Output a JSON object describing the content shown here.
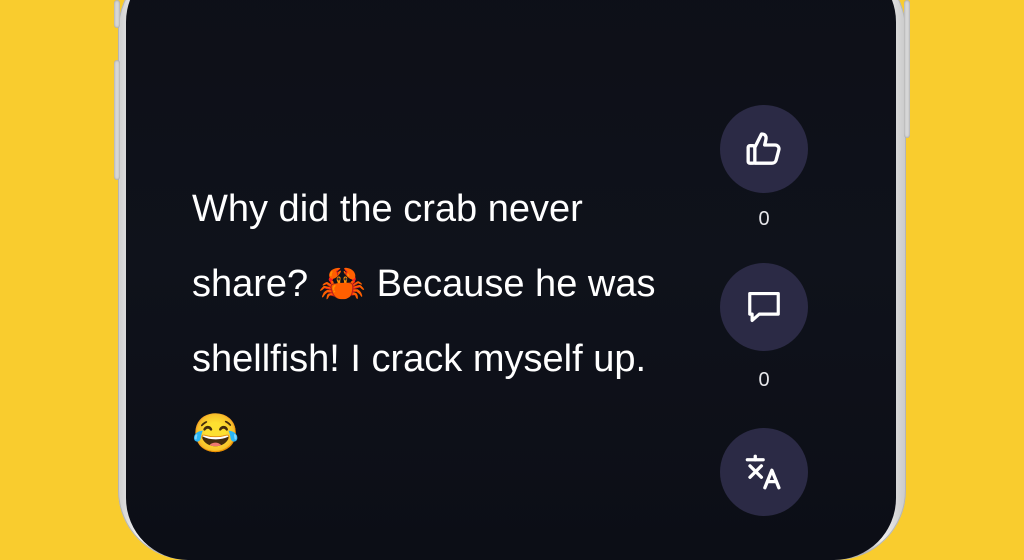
{
  "post": {
    "text": "Why did the crab never share? 🦀 Because he was shellfish! I crack myself up. 😂"
  },
  "actions": {
    "like": {
      "icon": "thumbs-up-icon",
      "count": "0"
    },
    "comment": {
      "icon": "comment-icon",
      "count": "0"
    },
    "translate": {
      "icon": "translate-icon"
    }
  },
  "colors": {
    "background": "#F9CC2E",
    "screen": "#0E1119",
    "action_button": "#2B2A45",
    "text": "#FFFFFF"
  }
}
